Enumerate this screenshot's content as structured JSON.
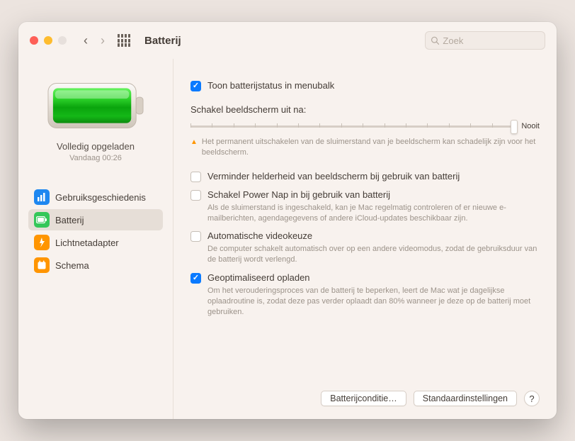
{
  "window": {
    "title": "Batterij",
    "back_enabled": true,
    "forward_enabled": false
  },
  "search": {
    "placeholder": "Zoek"
  },
  "sidebar": {
    "charge_status": "Volledig opgeladen",
    "charge_time": "Vandaag 00:26",
    "items": [
      {
        "label": "Gebruiksgeschiedenis",
        "selected": false
      },
      {
        "label": "Batterij",
        "selected": true
      },
      {
        "label": "Lichtnetadapter",
        "selected": false
      },
      {
        "label": "Schema",
        "selected": false
      }
    ]
  },
  "content": {
    "menubar_checkbox": {
      "checked": true,
      "label": "Toon batterijstatus in menubalk"
    },
    "display_sleep": {
      "title": "Schakel beeldscherm uit na:",
      "max_label": "Nooit",
      "warning": "Het permanent uitschakelen van de sluimerstand van je beeldscherm kan schadelijk zijn voor het beeldscherm."
    },
    "options": [
      {
        "checked": false,
        "label": "Verminder helderheid van beeldscherm bij gebruik van batterij",
        "sub": ""
      },
      {
        "checked": false,
        "label": "Schakel Power Nap in bij gebruik van batterij",
        "sub": "Als de sluimerstand is ingeschakeld, kan je Mac regelmatig controleren of er nieuwe e-mailberichten, agendagegevens of andere iCloud-updates beschikbaar zijn."
      },
      {
        "checked": false,
        "label": "Automatische videokeuze",
        "sub": "De computer schakelt automatisch over op een andere videomodus, zodat de gebruiksduur van de batterij wordt verlengd."
      },
      {
        "checked": true,
        "label": "Geoptimaliseerd opladen",
        "sub": "Om het verouderingsproces van de batterij te beperken, leert de Mac wat je dagelijkse oplaadroutine is, zodat deze pas verder oplaadt dan 80% wanneer je deze op de batterij moet gebruiken."
      }
    ],
    "footer": {
      "btn_health": "Batterijconditie…",
      "btn_defaults": "Standaardinstellingen",
      "btn_help": "?"
    }
  }
}
